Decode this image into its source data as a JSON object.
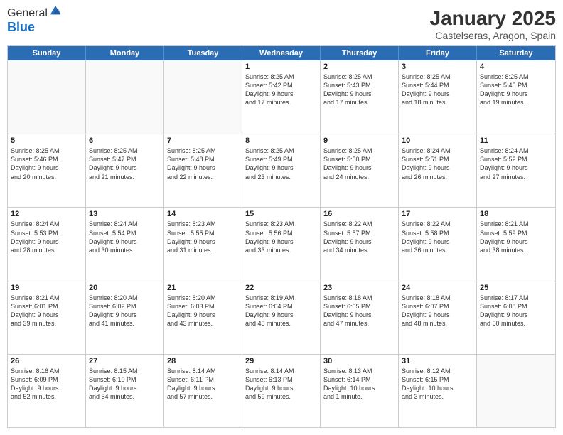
{
  "header": {
    "logo_line1": "General",
    "logo_line2": "Blue",
    "title": "January 2025",
    "subtitle": "Castelseras, Aragon, Spain"
  },
  "days_of_week": [
    "Sunday",
    "Monday",
    "Tuesday",
    "Wednesday",
    "Thursday",
    "Friday",
    "Saturday"
  ],
  "weeks": [
    [
      {
        "day": "",
        "text": ""
      },
      {
        "day": "",
        "text": ""
      },
      {
        "day": "",
        "text": ""
      },
      {
        "day": "1",
        "text": "Sunrise: 8:25 AM\nSunset: 5:42 PM\nDaylight: 9 hours\nand 17 minutes."
      },
      {
        "day": "2",
        "text": "Sunrise: 8:25 AM\nSunset: 5:43 PM\nDaylight: 9 hours\nand 17 minutes."
      },
      {
        "day": "3",
        "text": "Sunrise: 8:25 AM\nSunset: 5:44 PM\nDaylight: 9 hours\nand 18 minutes."
      },
      {
        "day": "4",
        "text": "Sunrise: 8:25 AM\nSunset: 5:45 PM\nDaylight: 9 hours\nand 19 minutes."
      }
    ],
    [
      {
        "day": "5",
        "text": "Sunrise: 8:25 AM\nSunset: 5:46 PM\nDaylight: 9 hours\nand 20 minutes."
      },
      {
        "day": "6",
        "text": "Sunrise: 8:25 AM\nSunset: 5:47 PM\nDaylight: 9 hours\nand 21 minutes."
      },
      {
        "day": "7",
        "text": "Sunrise: 8:25 AM\nSunset: 5:48 PM\nDaylight: 9 hours\nand 22 minutes."
      },
      {
        "day": "8",
        "text": "Sunrise: 8:25 AM\nSunset: 5:49 PM\nDaylight: 9 hours\nand 23 minutes."
      },
      {
        "day": "9",
        "text": "Sunrise: 8:25 AM\nSunset: 5:50 PM\nDaylight: 9 hours\nand 24 minutes."
      },
      {
        "day": "10",
        "text": "Sunrise: 8:24 AM\nSunset: 5:51 PM\nDaylight: 9 hours\nand 26 minutes."
      },
      {
        "day": "11",
        "text": "Sunrise: 8:24 AM\nSunset: 5:52 PM\nDaylight: 9 hours\nand 27 minutes."
      }
    ],
    [
      {
        "day": "12",
        "text": "Sunrise: 8:24 AM\nSunset: 5:53 PM\nDaylight: 9 hours\nand 28 minutes."
      },
      {
        "day": "13",
        "text": "Sunrise: 8:24 AM\nSunset: 5:54 PM\nDaylight: 9 hours\nand 30 minutes."
      },
      {
        "day": "14",
        "text": "Sunrise: 8:23 AM\nSunset: 5:55 PM\nDaylight: 9 hours\nand 31 minutes."
      },
      {
        "day": "15",
        "text": "Sunrise: 8:23 AM\nSunset: 5:56 PM\nDaylight: 9 hours\nand 33 minutes."
      },
      {
        "day": "16",
        "text": "Sunrise: 8:22 AM\nSunset: 5:57 PM\nDaylight: 9 hours\nand 34 minutes."
      },
      {
        "day": "17",
        "text": "Sunrise: 8:22 AM\nSunset: 5:58 PM\nDaylight: 9 hours\nand 36 minutes."
      },
      {
        "day": "18",
        "text": "Sunrise: 8:21 AM\nSunset: 5:59 PM\nDaylight: 9 hours\nand 38 minutes."
      }
    ],
    [
      {
        "day": "19",
        "text": "Sunrise: 8:21 AM\nSunset: 6:01 PM\nDaylight: 9 hours\nand 39 minutes."
      },
      {
        "day": "20",
        "text": "Sunrise: 8:20 AM\nSunset: 6:02 PM\nDaylight: 9 hours\nand 41 minutes."
      },
      {
        "day": "21",
        "text": "Sunrise: 8:20 AM\nSunset: 6:03 PM\nDaylight: 9 hours\nand 43 minutes."
      },
      {
        "day": "22",
        "text": "Sunrise: 8:19 AM\nSunset: 6:04 PM\nDaylight: 9 hours\nand 45 minutes."
      },
      {
        "day": "23",
        "text": "Sunrise: 8:18 AM\nSunset: 6:05 PM\nDaylight: 9 hours\nand 47 minutes."
      },
      {
        "day": "24",
        "text": "Sunrise: 8:18 AM\nSunset: 6:07 PM\nDaylight: 9 hours\nand 48 minutes."
      },
      {
        "day": "25",
        "text": "Sunrise: 8:17 AM\nSunset: 6:08 PM\nDaylight: 9 hours\nand 50 minutes."
      }
    ],
    [
      {
        "day": "26",
        "text": "Sunrise: 8:16 AM\nSunset: 6:09 PM\nDaylight: 9 hours\nand 52 minutes."
      },
      {
        "day": "27",
        "text": "Sunrise: 8:15 AM\nSunset: 6:10 PM\nDaylight: 9 hours\nand 54 minutes."
      },
      {
        "day": "28",
        "text": "Sunrise: 8:14 AM\nSunset: 6:11 PM\nDaylight: 9 hours\nand 57 minutes."
      },
      {
        "day": "29",
        "text": "Sunrise: 8:14 AM\nSunset: 6:13 PM\nDaylight: 9 hours\nand 59 minutes."
      },
      {
        "day": "30",
        "text": "Sunrise: 8:13 AM\nSunset: 6:14 PM\nDaylight: 10 hours\nand 1 minute."
      },
      {
        "day": "31",
        "text": "Sunrise: 8:12 AM\nSunset: 6:15 PM\nDaylight: 10 hours\nand 3 minutes."
      },
      {
        "day": "",
        "text": ""
      }
    ]
  ]
}
